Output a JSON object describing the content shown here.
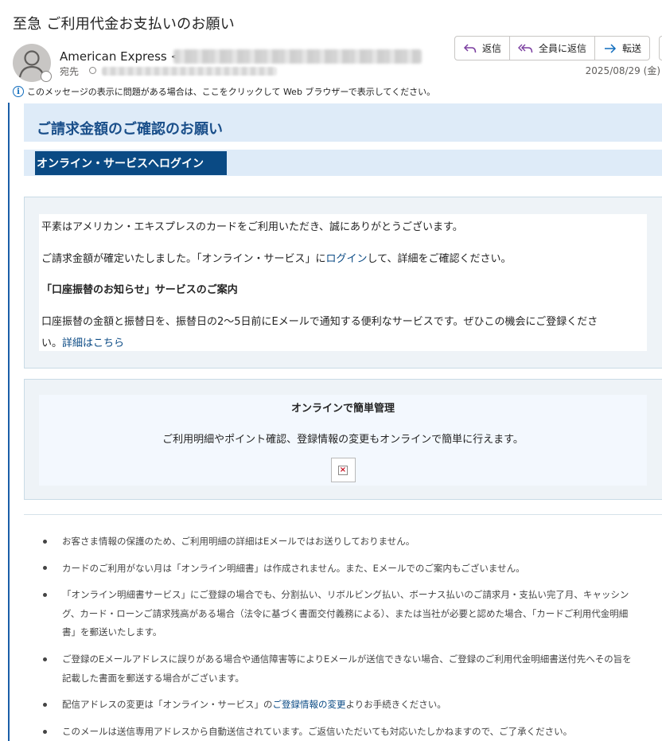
{
  "email": {
    "subject": "至急  ご利用代金お支払いのお願い",
    "sender_name": "American Express <",
    "to_label": "宛先",
    "date": "2025/08/29 (金)",
    "info_bar": "このメッセージの表示に問題がある場合は、ここをクリックして Web ブラウザーで表示してください。"
  },
  "actions": {
    "reply": "返信",
    "reply_all": "全員に返信",
    "forward": "転送"
  },
  "content": {
    "header_title": "ご請求金額のご確認のお願い",
    "login_button": "オンライン・サービスへログイン",
    "p1": "平素はアメリカン・エキスプレスのカードをご利用いただき、誠にありがとうございます。",
    "p2_pre": "ご請求金額が確定いたしました。「オンライン・サービス」に",
    "p2_link": "ログイン",
    "p2_post": "して、詳細をご確認ください。",
    "section_heading": "「口座振替のお知らせ」サービスのご案内",
    "p3_line1": "口座振替の金額と振替日を、振替日の2〜5日前にEメールで通知する便利なサービスです。ぜひこの機会にご登録くださ",
    "p3_line2_pre": "い。",
    "p3_link": "詳細はこちら",
    "online_heading": "オンラインで簡単管理",
    "online_desc": "ご利用明細やポイント確認、登録情報の変更もオンラインで簡単に行えます。"
  },
  "notes": {
    "n1": "お客さま情報の保護のため、ご利用明細の詳細はEメールではお送りしておりません。",
    "n2": "カードのご利用がない月は「オンライン明細書」は作成されません。また、Eメールでのご案内もございません。",
    "n3_l1": "「オンライン明細書サービス」にご登録の場合でも、分割払い、リボルビング払い、ボーナス払いのご請求月・支払い完了月、キャッシン",
    "n3_l2": "グ、カード・ローンご請求残高がある場合（法令に基づく書面交付義務による）、または当社が必要と認めた場合、「カードご利用代金明細",
    "n3_l3": "書」を郵送いたします。",
    "n4_l1": "ご登録のEメールアドレスに誤りがある場合や通信障害等によりEメールが送信できない場合、ご登録のご利用代金明細書送付先へその旨を",
    "n4_l2": "記載した書面を郵送する場合がございます。",
    "n5_pre": "配信アドレスの変更は「オンライン・サービス」の",
    "n5_link": "ご登録情報の変更",
    "n5_post": "よりお手続きください。",
    "n6": "このメールは送信専用アドレスから自動送信されています。ご返信いただいても対応いたしかねますので、ご了承ください。"
  },
  "colors": {
    "brand_blue": "#0a4a84",
    "band_light": "#deebf8",
    "accent_border": "#1b5ea8"
  }
}
